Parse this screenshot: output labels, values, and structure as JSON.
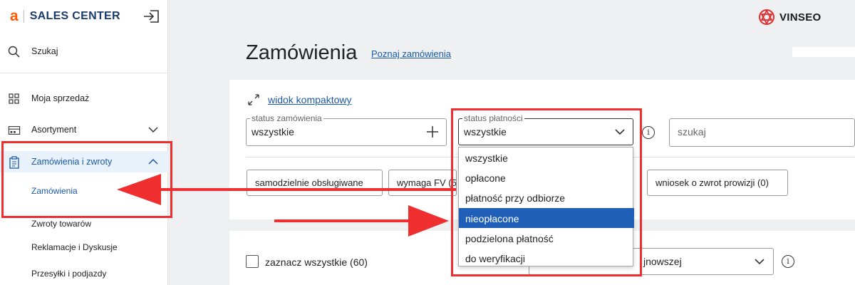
{
  "sidebar": {
    "brand_letter": "a",
    "brand_name": "SALES CENTER",
    "items": [
      {
        "label": "Szukaj",
        "icon": "search-icon"
      },
      {
        "label": "Moja sprzedaż",
        "icon": "grid-icon"
      },
      {
        "label": "Asortyment",
        "icon": "storefront-icon"
      },
      {
        "label": "Zamówienia i zwroty",
        "icon": "clipboard-icon"
      }
    ],
    "sub_items": [
      {
        "label": "Zamówienia"
      },
      {
        "label": "Zwroty towarów"
      },
      {
        "label": "Reklamacje i Dyskusje"
      },
      {
        "label": "Przesyłki i podjazdy"
      }
    ]
  },
  "topbar": {
    "brand": "VINSEO"
  },
  "page": {
    "title": "Zamówienia",
    "help_link": "Poznaj zamówienia"
  },
  "filters": {
    "compact_view": "widok kompaktowy",
    "order_status": {
      "legend": "status zamówienia",
      "value": "wszystkie"
    },
    "payment_status": {
      "legend": "status płatności",
      "value": "wszystkie",
      "options": [
        "wszystkie",
        "opłacone",
        "płatność przy odbiorze",
        "nieopłacone",
        "podzielona płatność",
        "do weryfikacji"
      ],
      "highlighted": "nieopłacone"
    },
    "search_placeholder": "szukaj",
    "chips": [
      "samodzielnie obsługiwane",
      "wymaga FV (5",
      "wniosek o zwrot prowizji (0)"
    ]
  },
  "list": {
    "select_all": "zaznacz wszystkie (60)",
    "sort_value_partial": "jnowszej"
  },
  "colors": {
    "accent": "#1a5aa8",
    "annotation": "#ef2f2f",
    "brand_orange": "#ff5a00",
    "selected_option": "#1f5fb7"
  }
}
